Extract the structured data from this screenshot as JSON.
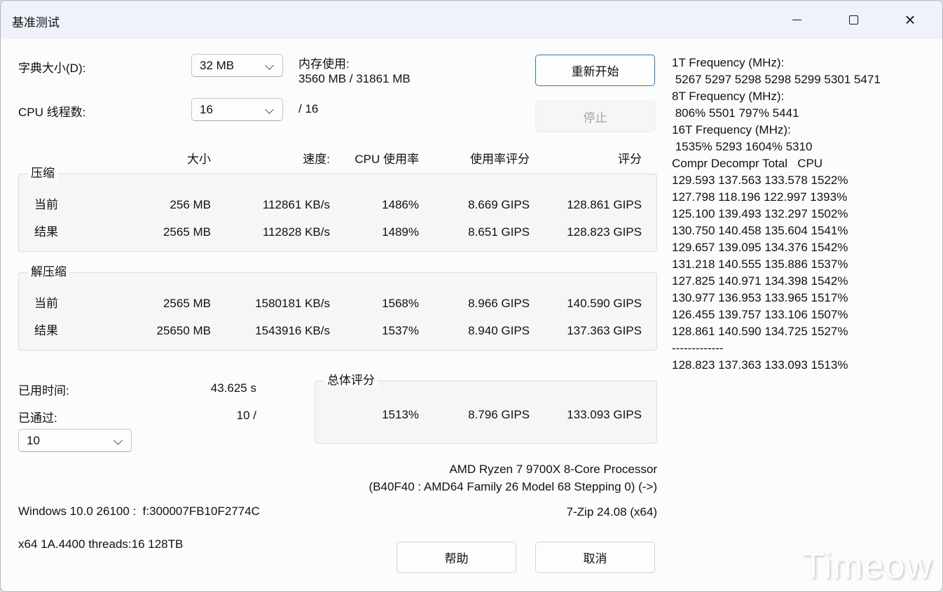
{
  "window": {
    "title": "基准测试"
  },
  "icons": {
    "close": "×"
  },
  "controls": {
    "dictionary_label": "字典大小(D):",
    "dictionary_value": "32 MB",
    "memory_label": "内存使用:",
    "memory_value": "3560 MB / 31861 MB",
    "threads_label": "CPU 线程数:",
    "threads_value": "16",
    "threads_total": "/ 16",
    "restart_button": "重新开始",
    "stop_button": "停止"
  },
  "table": {
    "headers": {
      "size": "大小",
      "speed": "速度:",
      "cpu": "CPU 使用率",
      "usage_rating": "使用率评分",
      "rating": "评分"
    },
    "compression": {
      "label": "压缩",
      "rows": [
        {
          "label": "当前",
          "size": "256 MB",
          "speed": "112861 KB/s",
          "cpu": "1486%",
          "usage_rating": "8.669 GIPS",
          "rating": "128.861 GIPS"
        },
        {
          "label": "结果",
          "size": "2565 MB",
          "speed": "112828 KB/s",
          "cpu": "1489%",
          "usage_rating": "8.651 GIPS",
          "rating": "128.823 GIPS"
        }
      ]
    },
    "decompression": {
      "label": "解压缩",
      "rows": [
        {
          "label": "当前",
          "size": "2565 MB",
          "speed": "1580181 KB/s",
          "cpu": "1568%",
          "usage_rating": "8.966 GIPS",
          "rating": "140.590 GIPS"
        },
        {
          "label": "结果",
          "size": "25650 MB",
          "speed": "1543916 KB/s",
          "cpu": "1537%",
          "usage_rating": "8.940 GIPS",
          "rating": "137.363 GIPS"
        }
      ]
    },
    "total": {
      "label": "总体评分",
      "cpu": "1513%",
      "usage_rating": "8.796 GIPS",
      "rating": "133.093 GIPS"
    }
  },
  "status": {
    "elapsed_label": "已用时间:",
    "elapsed_value": "43.625 s",
    "passes_label": "已通过:",
    "passes_value": "10 /",
    "passes_dropdown": "10"
  },
  "freq_panel": {
    "lines": [
      "1T Frequency (MHz):",
      " 5267 5297 5298 5298 5299 5301 5471",
      "8T Frequency (MHz):",
      " 806% 5501 797% 5441",
      "16T Frequency (MHz):",
      " 1535% 5293 1604% 5310",
      "Compr Decompr Total   CPU",
      "129.593 137.563 133.578 1522%",
      "127.798 118.196 122.997 1393%",
      "125.100 139.493 132.297 1502%",
      "130.750 140.458 135.604 1541%",
      "129.657 139.095 134.376 1542%",
      "131.218 140.555 135.886 1537%",
      "127.825 140.971 134.398 1542%",
      "130.977 136.953 133.965 1517%",
      "126.455 139.757 133.106 1507%",
      "128.861 140.590 134.725 1527%",
      "-------------",
      "128.823 137.363 133.093 1513%"
    ]
  },
  "sysinfo": {
    "cpu_line1": "AMD Ryzen 7 9700X 8-Core Processor",
    "cpu_line2": "(B40F40 : AMD64 Family 26 Model 68 Stepping 0) (->)",
    "windows_line": "Windows 10.0 26100 :  f:300007FB10F2774C",
    "app_version": "7-Zip 24.08 (x64)",
    "arch_line": "x64 1A.4400 threads:16 128TB"
  },
  "footer": {
    "help_button": "帮助",
    "cancel_button": "取消"
  },
  "watermark": "Timeow"
}
